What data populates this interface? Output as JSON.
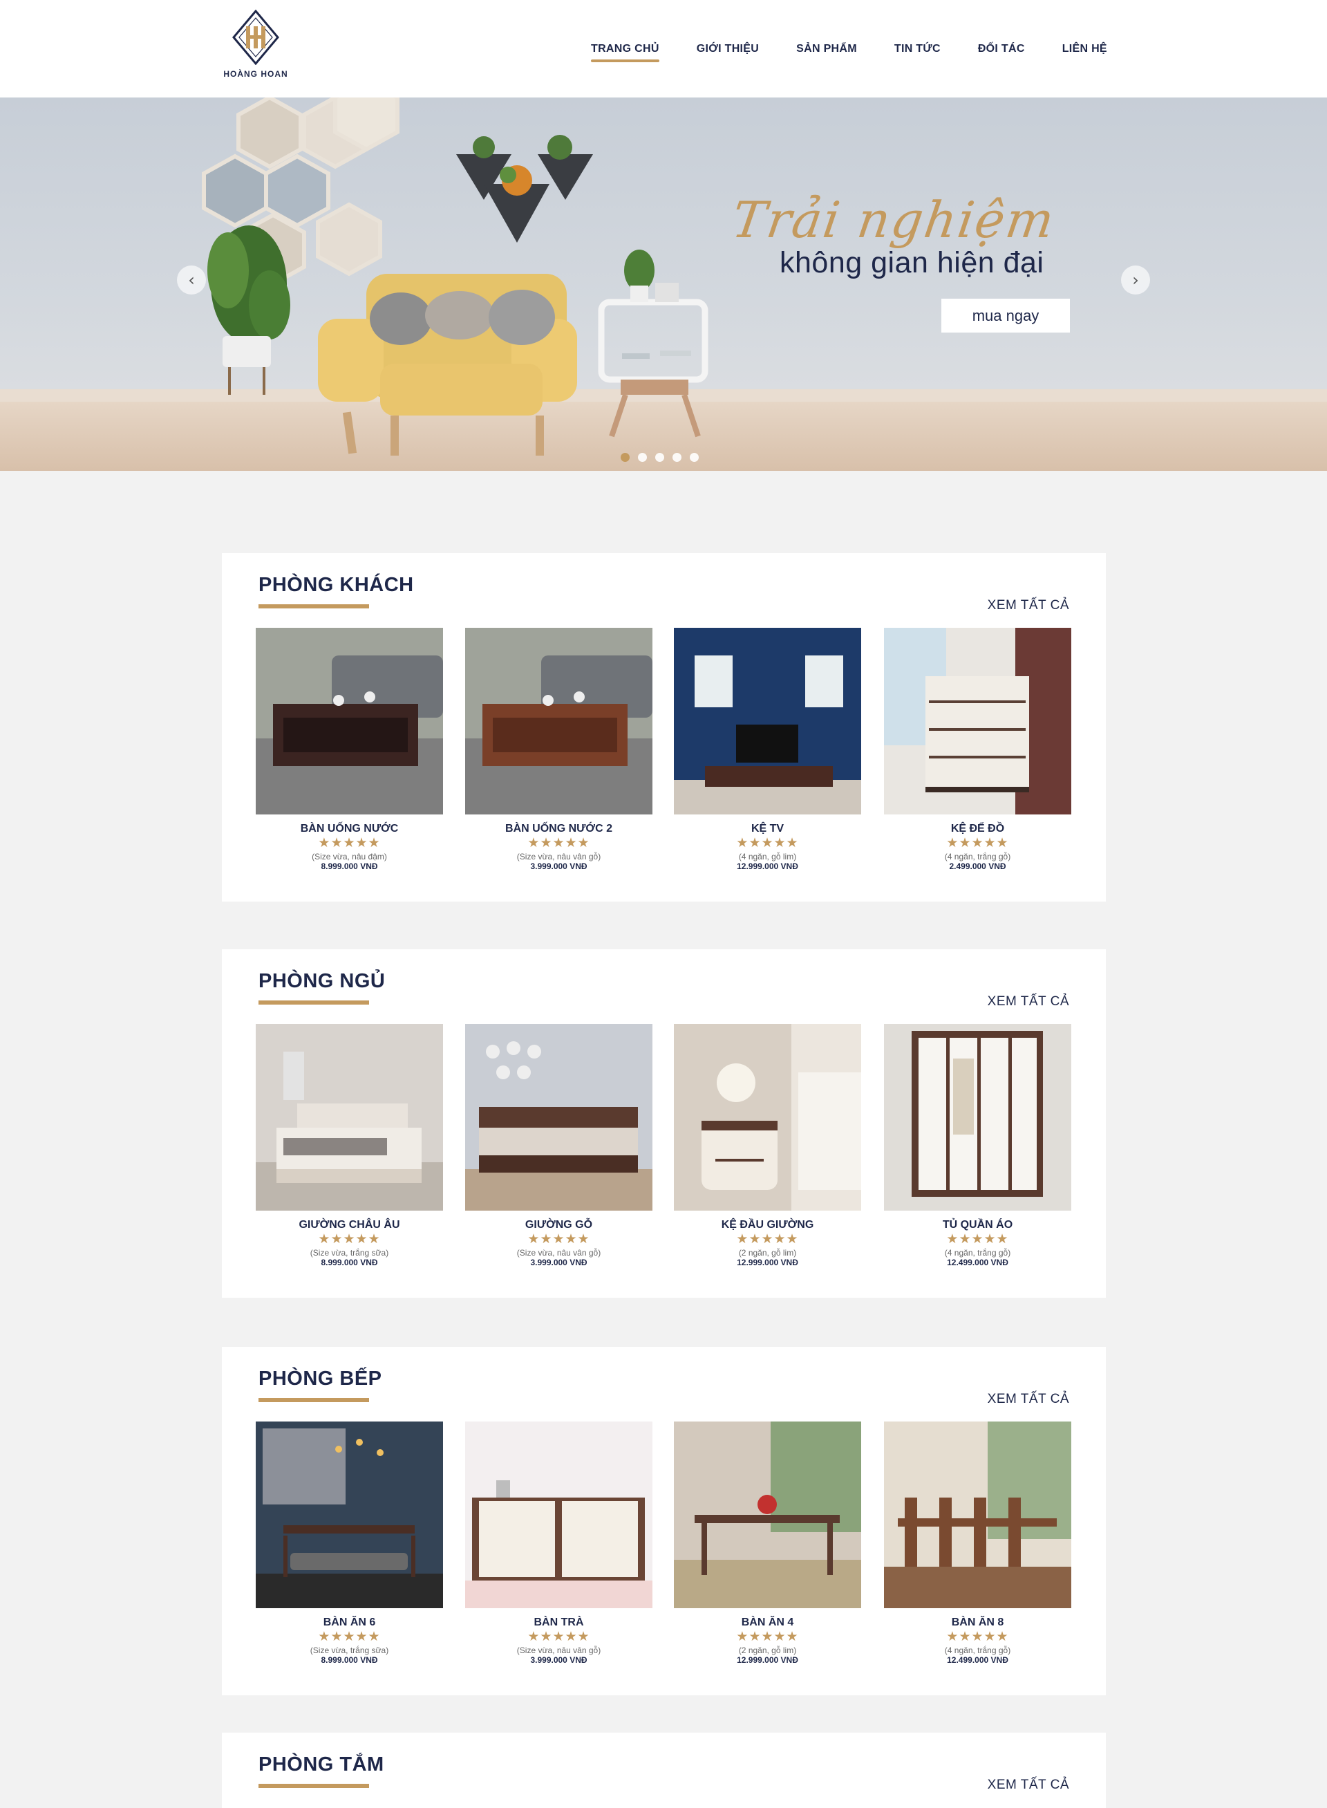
{
  "brand": {
    "name": "HOÀNG HOAN",
    "monogram": "HH",
    "accent": "#c49a5e",
    "navy": "#1e2749"
  },
  "nav": [
    {
      "label": "TRANG CHỦ",
      "active": true
    },
    {
      "label": "GIỚI THIỆU",
      "active": false
    },
    {
      "label": "SẢN PHẨM",
      "active": false
    },
    {
      "label": "TIN TỨC",
      "active": false
    },
    {
      "label": "ĐỐI TÁC",
      "active": false
    },
    {
      "label": "LIÊN HỆ",
      "active": false
    }
  ],
  "banner": {
    "script_title": "Trải nghiệm",
    "main_title": "không gian hiện đại",
    "cta_label": "mua ngay",
    "prev_icon": "‹",
    "next_icon": "›",
    "slide_count": 5,
    "active_slide": 1
  },
  "sections": [
    {
      "title": "PHÒNG KHÁCH",
      "see_all": "XEM TẤT CẢ",
      "products": [
        {
          "name": "BÀN UỐNG NƯỚC",
          "stars": "★★★★★",
          "desc": "(Size vừa, nâu đậm)",
          "price": "8.999.000 VNĐ"
        },
        {
          "name": "BÀN UỐNG NƯỚC 2",
          "stars": "★★★★★",
          "desc": "(Size vừa, nâu vân gỗ)",
          "price": "3.999.000 VNĐ"
        },
        {
          "name": "KỆ TV",
          "stars": "★★★★★",
          "desc": "(4 ngăn, gỗ lim)",
          "price": "12.999.000 VNĐ"
        },
        {
          "name": "KỆ ĐỂ ĐỒ",
          "stars": "★★★★★",
          "desc": "(4 ngăn, trắng gỗ)",
          "price": "2.499.000 VNĐ"
        }
      ]
    },
    {
      "title": "PHÒNG NGỦ",
      "see_all": "XEM TẤT CẢ",
      "products": [
        {
          "name": "GIƯỜNG CHÂU ÂU",
          "stars": "★★★★★",
          "desc": "(Size vừa, trắng sữa)",
          "price": "8.999.000 VNĐ"
        },
        {
          "name": "GIƯỜNG GỖ",
          "stars": "★★★★★",
          "desc": "(Size vừa, nâu vân gỗ)",
          "price": "3.999.000 VNĐ"
        },
        {
          "name": "KỆ ĐẦU GIƯỜNG",
          "stars": "★★★★★",
          "desc": "(2 ngăn, gỗ lim)",
          "price": "12.999.000 VNĐ"
        },
        {
          "name": "TỦ QUẦN ÁO",
          "stars": "★★★★★",
          "desc": "(4 ngăn, trắng gỗ)",
          "price": "12.499.000 VNĐ"
        }
      ]
    },
    {
      "title": "PHÒNG BẾP",
      "see_all": "XEM TẤT CẢ",
      "products": [
        {
          "name": "BÀN ĂN 6",
          "stars": "★★★★★",
          "desc": "(Size vừa, trắng sữa)",
          "price": "8.999.000 VNĐ"
        },
        {
          "name": "BÀN TRÀ",
          "stars": "★★★★★",
          "desc": "(Size vừa, nâu vân gỗ)",
          "price": "3.999.000 VNĐ"
        },
        {
          "name": "BÀN ĂN 4",
          "stars": "★★★★★",
          "desc": "(2 ngăn, gỗ lim)",
          "price": "12.999.000 VNĐ"
        },
        {
          "name": "BÀN ĂN 8",
          "stars": "★★★★★",
          "desc": "(4 ngăn, trắng gỗ)",
          "price": "12.499.000 VNĐ"
        }
      ]
    },
    {
      "title": "PHÒNG TẮM",
      "see_all": "XEM TẤT CẢ",
      "products": []
    }
  ]
}
